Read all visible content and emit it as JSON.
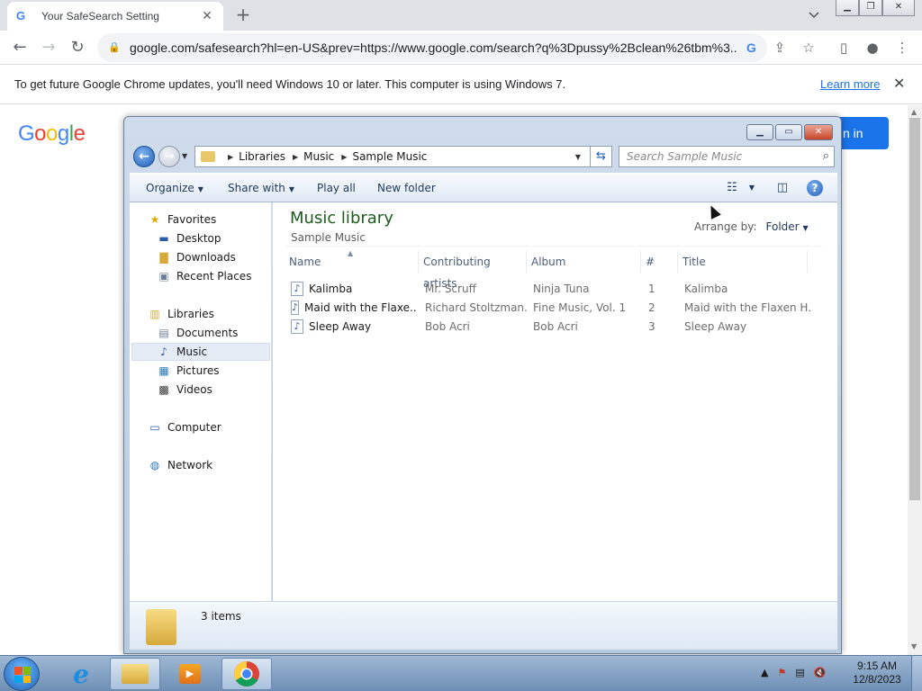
{
  "chrome": {
    "tab_title": "Your SafeSearch Setting",
    "tab_close": "✕",
    "new_tab": "+",
    "url": "google.com/safesearch?hl=en-US&prev=https://www.google.com/search?q%3Dpussy%2Bclean%26tbm%3...",
    "infobar_message": "To get future Google Chrome updates, you'll need Windows 10 or later. This computer is using Windows 7.",
    "infobar_link": "Learn more",
    "infobar_close": "✕"
  },
  "page": {
    "logo": [
      "G",
      "o",
      "o",
      "g",
      "l",
      "e"
    ],
    "signin_label": "n in"
  },
  "explorer": {
    "breadcrumb": [
      "Libraries",
      "Music",
      "Sample Music"
    ],
    "search_placeholder": "Search Sample Music",
    "commands": {
      "organize": "Organize",
      "share_with": "Share with",
      "play_all": "Play all",
      "new_folder": "New folder"
    },
    "nav": {
      "favorites": "Favorites",
      "desktop": "Desktop",
      "downloads": "Downloads",
      "recent": "Recent Places",
      "libraries": "Libraries",
      "documents": "Documents",
      "music": "Music",
      "pictures": "Pictures",
      "videos": "Videos",
      "computer": "Computer",
      "network": "Network"
    },
    "library_title": "Music library",
    "library_subtitle": "Sample Music",
    "arrange_label": "Arrange by:",
    "arrange_value": "Folder",
    "columns": [
      "Name",
      "Contributing artists",
      "Album",
      "#",
      "Title"
    ],
    "rows": [
      {
        "name": "Kalimba",
        "artist": "Mr. Scruff",
        "album": "Ninja Tuna",
        "num": "1",
        "title": "Kalimba"
      },
      {
        "name": "Maid with the Flaxe...",
        "artist": "Richard Stoltzman...",
        "album": "Fine Music, Vol. 1",
        "num": "2",
        "title": "Maid with the Flaxen H..."
      },
      {
        "name": "Sleep Away",
        "artist": "Bob Acri",
        "album": "Bob Acri",
        "num": "3",
        "title": "Sleep Away"
      }
    ],
    "item_count": "3 items"
  },
  "taskbar": {
    "time": "9:15 AM",
    "date": "12/8/2023"
  },
  "colors": {
    "chrome_blue": "#1a73e8",
    "library_green": "#1e5b1e"
  }
}
